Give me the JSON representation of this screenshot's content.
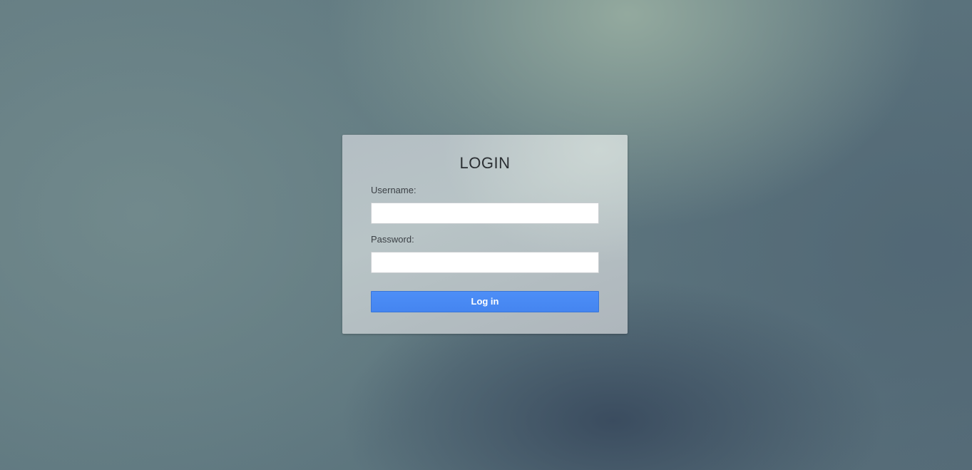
{
  "login": {
    "title": "LOGIN",
    "username_label": "Username:",
    "username_value": "",
    "password_label": "Password:",
    "password_value": "",
    "submit_label": "Log in"
  },
  "colors": {
    "button_primary": "#4a8af4",
    "card_background": "#b6c0c5"
  }
}
